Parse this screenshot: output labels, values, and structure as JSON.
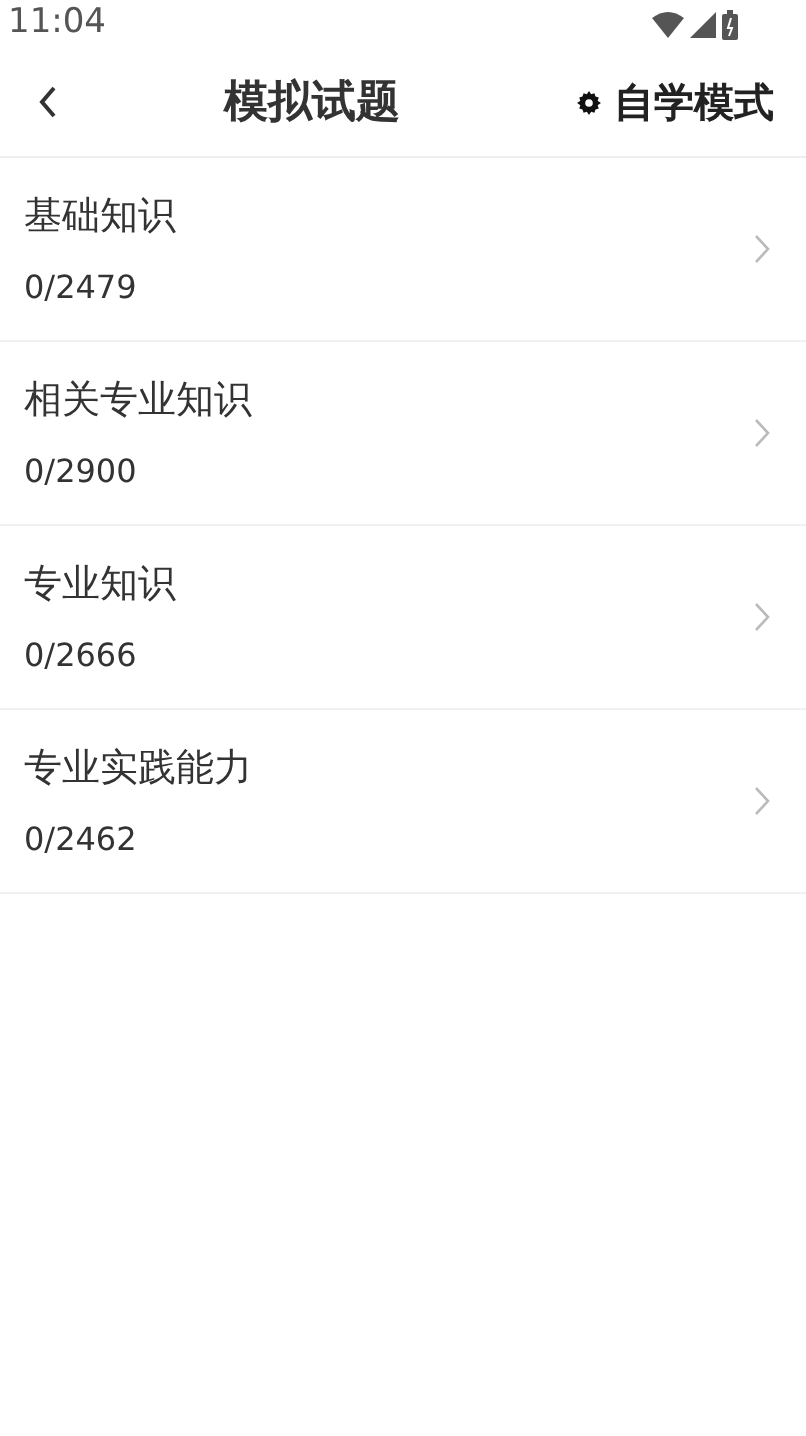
{
  "status_bar": {
    "time": "11:04"
  },
  "header": {
    "title": "模拟试题",
    "mode_button": "自学模式"
  },
  "items": [
    {
      "title": "基础知识",
      "progress": "0/2479"
    },
    {
      "title": "相关专业知识",
      "progress": "0/2900"
    },
    {
      "title": "专业知识",
      "progress": "0/2666"
    },
    {
      "title": "专业实践能力",
      "progress": "0/2462"
    }
  ]
}
